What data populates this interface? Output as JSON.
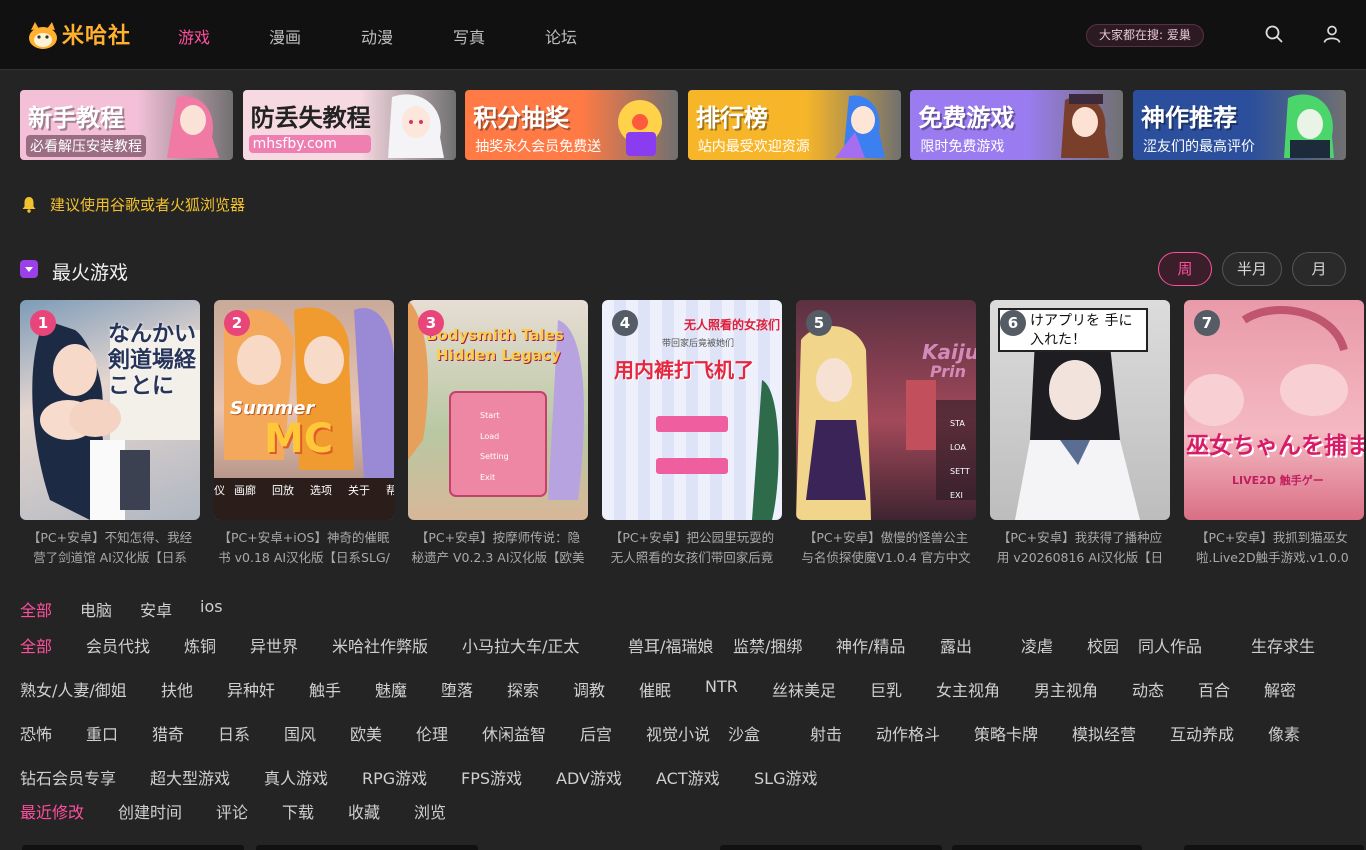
{
  "header": {
    "logo_text": "米哈社",
    "nav": [
      "游戏",
      "漫画",
      "动漫",
      "写真",
      "论坛"
    ],
    "active_nav": "游戏",
    "hot_search": "大家都在搜: 爱巢",
    "icons": [
      "search-icon",
      "user-icon"
    ]
  },
  "banners": [
    {
      "title": "新手教程",
      "subtitle": "必看解压安装教程",
      "bg": "#f3c0d8"
    },
    {
      "title": "防丢失教程",
      "subtitle": "mhsfby.com",
      "bg": "#f7d9e2"
    },
    {
      "title": "积分抽奖",
      "subtitle": "抽奖永久会员免费送",
      "bg": "#ff7a45"
    },
    {
      "title": "排行榜",
      "subtitle": "站内最受欢迎资源",
      "bg": "#f7b629"
    },
    {
      "title": "免费游戏",
      "subtitle": "限时免费游戏",
      "bg": "#9a7cf0"
    },
    {
      "title": "神作推荐",
      "subtitle": "涩友们的最高评价",
      "bg": "#2b4f9c"
    }
  ],
  "notice": "建议使用谷歌或者火狐浏览器",
  "hot_games": {
    "title": "最火游戏",
    "periods": [
      "周",
      "半月",
      "月"
    ],
    "active_period": "周",
    "games": [
      {
        "rank": "1",
        "line1": "【PC+安卓】不知怎得、我经",
        "line2": "营了剑道馆 AI汉化版【日系",
        "badge": "#e8467a"
      },
      {
        "rank": "2",
        "line1": "【PC+安卓+iOS】神奇的催眠",
        "line2": "书 v0.18 AI汉化版【日系SLG/",
        "badge": "#e8467a"
      },
      {
        "rank": "3",
        "line1": "【PC+安卓】按摩师传说：隐",
        "line2": "秘遗产 V0.2.3 AI汉化版【欧美",
        "badge": "#e8467a"
      },
      {
        "rank": "4",
        "line1": "【PC+安卓】把公园里玩耍的",
        "line2": "无人照看的女孩们带回家后竟",
        "badge": "#555c66"
      },
      {
        "rank": "5",
        "line1": "【PC+安卓】傲慢的怪兽公主",
        "line2": "与名侦探使魔V1.0.4 官方中文",
        "badge": "#555c66"
      },
      {
        "rank": "6",
        "line1": "【PC+安卓】我获得了播种应",
        "line2": "用 v20260816 AI汉化版【日",
        "badge": "#555c66"
      },
      {
        "rank": "7",
        "line1": "【PC+安卓】我抓到猫巫女",
        "line2": "啦.Live2D触手游戏.v1.0.0",
        "badge": "#555c66"
      }
    ],
    "thumb_text": {
      "g1": "なんかい剣道場経ことに",
      "g2_logo": "Summer",
      "g2_logo2": "MC",
      "g2_menu": [
        "仪",
        "画廊",
        "回放",
        "选项",
        "关于",
        "帮"
      ],
      "g3_title": "Bodysmith Tales",
      "g3_title2": "Hidden Legacy",
      "g3_menu": [
        "Start",
        "Load",
        "Setting",
        "Exit"
      ],
      "g4_top": "无人照看的女孩们",
      "g4_sub": "带回家后竟被她们",
      "g4_main": "用内裤打飞机了",
      "g5_title": "Kaiju",
      "g5_title2": "Prin",
      "g5_menu": [
        "STA",
        "LOA",
        "SETT",
        "EXI"
      ],
      "g6_text": "けアプリを 手に入れた！",
      "g7_text": "巫女ちゃんを捕ま",
      "g7_sub": "LIVE2D 触手ゲー"
    }
  },
  "platform_filters": [
    "全部",
    "电脑",
    "安卓",
    "ios"
  ],
  "category_rows": [
    [
      "全部",
      "会员代找",
      "炼铜",
      "异世界",
      "米哈社作弊版",
      "小马拉大车/正太",
      "兽耳/福瑞娘",
      "监禁/捆绑",
      "神作/精品",
      "露出",
      "凌虐",
      "校园",
      "同人作品",
      "生存求生"
    ],
    [
      "熟女/人妻/御姐",
      "扶他",
      "异种奸",
      "触手",
      "魅魔",
      "堕落",
      "探索",
      "调教",
      "催眠",
      "NTR",
      "丝袜美足",
      "巨乳",
      "女主视角",
      "男主视角",
      "动态",
      "百合",
      "解密"
    ],
    [
      "恐怖",
      "重口",
      "猎奇",
      "日系",
      "国风",
      "欧美",
      "伦理",
      "休闲益智",
      "后宫",
      "视觉小说",
      "沙盒",
      "射击",
      "动作格斗",
      "策略卡牌",
      "模拟经营",
      "互动养成",
      "像素"
    ],
    [
      "钻石会员专享",
      "超大型游戏",
      "真人游戏",
      "RPG游戏",
      "FPS游戏",
      "ADV游戏",
      "ACT游戏",
      "SLG游戏"
    ]
  ],
  "sort_options": [
    "最近修改",
    "创建时间",
    "评论",
    "下载",
    "收藏",
    "浏览"
  ],
  "colors": {
    "accent": "#ff4f9e",
    "notice": "#f2c12e",
    "background": "#242424",
    "header": "#111111"
  }
}
